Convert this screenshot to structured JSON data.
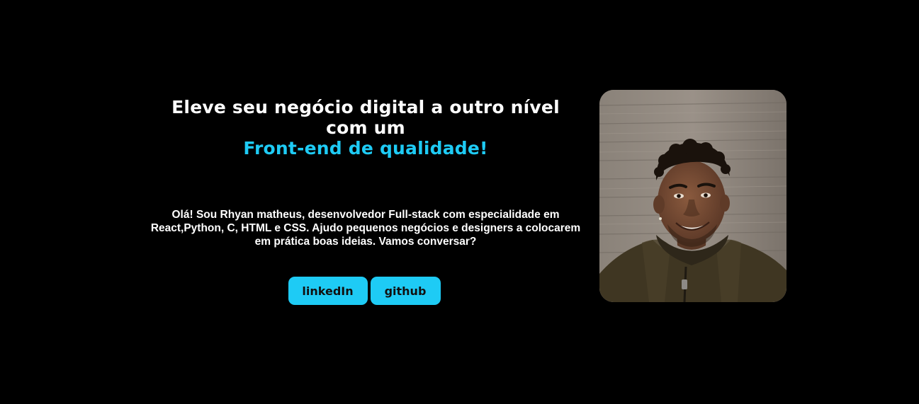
{
  "hero": {
    "headline_line1": "Eleve seu negócio digital a outro nível",
    "headline_line2": "com um",
    "headline_accent": "Front-end de qualidade!",
    "intro_part1": "Olá! Sou Rhyan matheus, desenvolvedor Full-stack com especialidade em ",
    "intro_bold": "React,Python, C, HTML e CSS.",
    "intro_part2": " Ajudo pequenos negócios e designers a colocarem em prática boas ideias. Vamos conversar?"
  },
  "buttons": {
    "linkedin_label": "linkedIn",
    "github_label": "github"
  },
  "colors": {
    "background": "#000000",
    "accent": "#1ecbf5",
    "text": "#ffffff"
  },
  "photo": {
    "alt": "profile-photo"
  }
}
